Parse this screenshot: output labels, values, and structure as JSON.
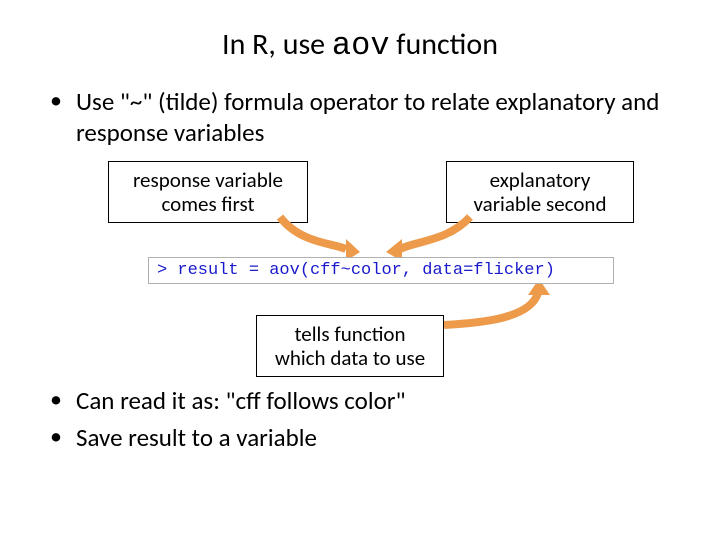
{
  "title": {
    "pre": "In R, use ",
    "fn": "aov",
    "post": " function"
  },
  "bullets_top": [
    "Use \"~\" (tilde) formula operator to relate explanatory and response variables"
  ],
  "boxes": {
    "response": {
      "l1": "response variable",
      "l2": "comes first"
    },
    "explanatory": {
      "l1": "explanatory",
      "l2": "variable second"
    },
    "data": {
      "l1": "tells function",
      "l2": "which data to use"
    }
  },
  "code": {
    "prompt": "> ",
    "lhs": "result = aov(",
    "cff": "cff",
    "tilde": "~",
    "color": "color",
    "sep": ", ",
    "dataarg": "data=flicker",
    "close": ")"
  },
  "bullets_bottom": [
    "Can read it as: \"cff follows color\"",
    "Save result to a variable"
  ]
}
